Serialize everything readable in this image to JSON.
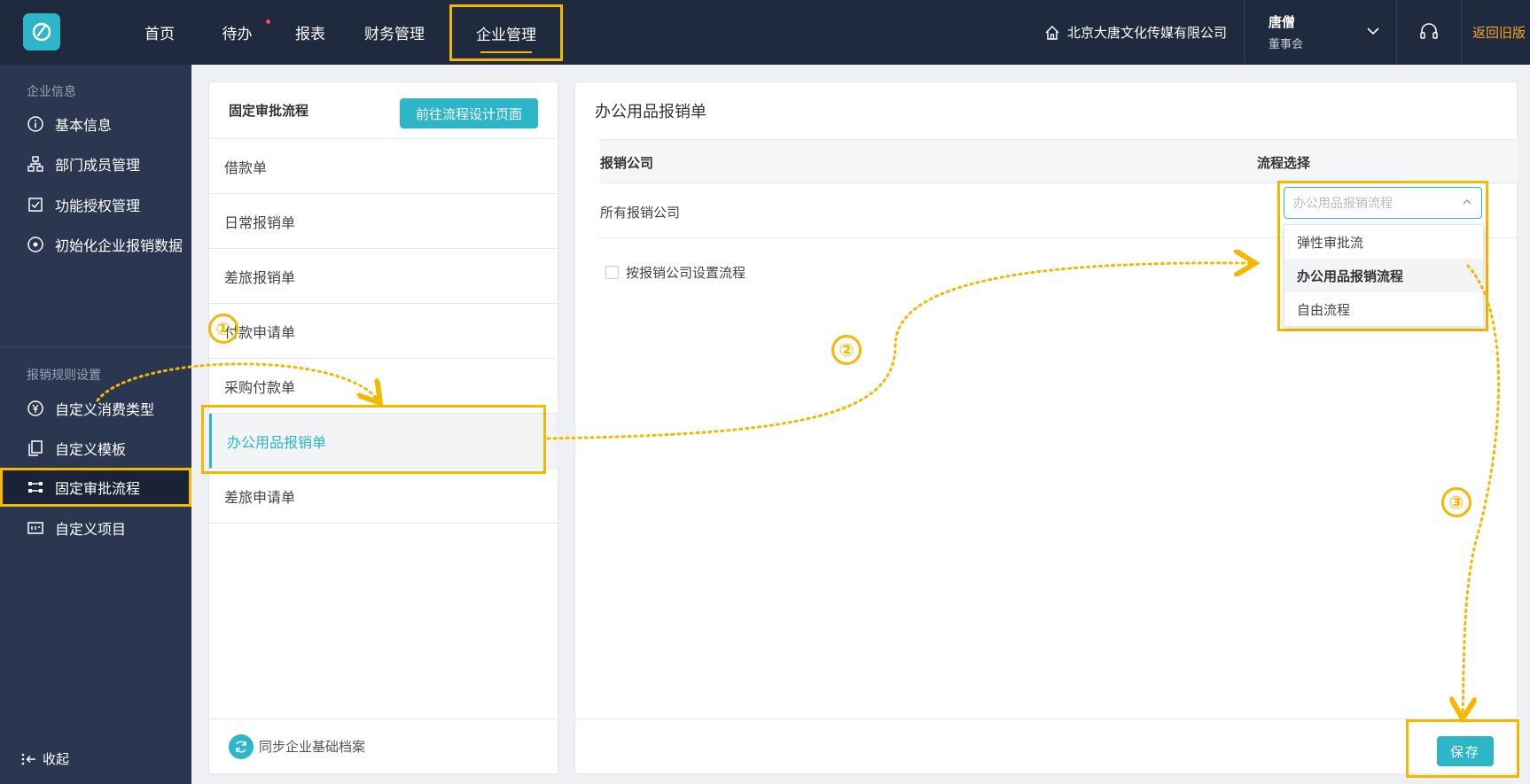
{
  "topbar": {
    "nav": [
      {
        "label": "首页",
        "badge": false
      },
      {
        "label": "待办",
        "badge": true
      },
      {
        "label": "报表",
        "badge": false
      },
      {
        "label": "财务管理",
        "badge": false
      },
      {
        "label": "企业管理",
        "badge": false,
        "active": true
      }
    ],
    "company": "北京大唐文化传媒有限公司",
    "user_name": "唐僧",
    "user_role": "董事会",
    "back_old": "返回旧版"
  },
  "sidebar": {
    "section1": "企业信息",
    "section2": "报销规则设置",
    "items": [
      {
        "label": "基本信息",
        "icon": "info-icon"
      },
      {
        "label": "部门成员管理",
        "icon": "org-chart-icon"
      },
      {
        "label": "功能授权管理",
        "icon": "checkbox-icon"
      },
      {
        "label": "初始化企业报销数据",
        "icon": "target-icon"
      },
      {
        "label": "自定义消费类型",
        "icon": "yen-icon"
      },
      {
        "label": "自定义模板",
        "icon": "copy-icon"
      },
      {
        "label": "固定审批流程",
        "icon": "flow-icon",
        "active": true
      },
      {
        "label": "自定义项目",
        "icon": "project-icon"
      }
    ],
    "collapse": "收起"
  },
  "left_panel": {
    "title": "固定审批流程",
    "goto_button": "前往流程设计页面",
    "items": [
      "借款单",
      "日常报销单",
      "差旅报销单",
      "付款申请单",
      "采购付款单",
      "办公用品报销单",
      "差旅申请单"
    ],
    "active_index": 5,
    "sync": "同步企业基础档案"
  },
  "right_panel": {
    "title": "办公用品报销单",
    "col_company": "报销公司",
    "col_flow": "流程选择",
    "row_company": "所有报销公司",
    "select_placeholder": "办公用品报销流程",
    "options": [
      "弹性审批流",
      "办公用品报销流程",
      "自由流程"
    ],
    "selected_option": 1,
    "checkbox_label": "按报销公司设置流程",
    "save": "保存"
  },
  "annotations": {
    "step1": "①",
    "step2": "②",
    "step3": "③"
  },
  "colors": {
    "accent": "#2cb6c8",
    "highlight": "#f5b800",
    "topbar": "#1f2a3f",
    "sidebar": "#2b3750"
  }
}
